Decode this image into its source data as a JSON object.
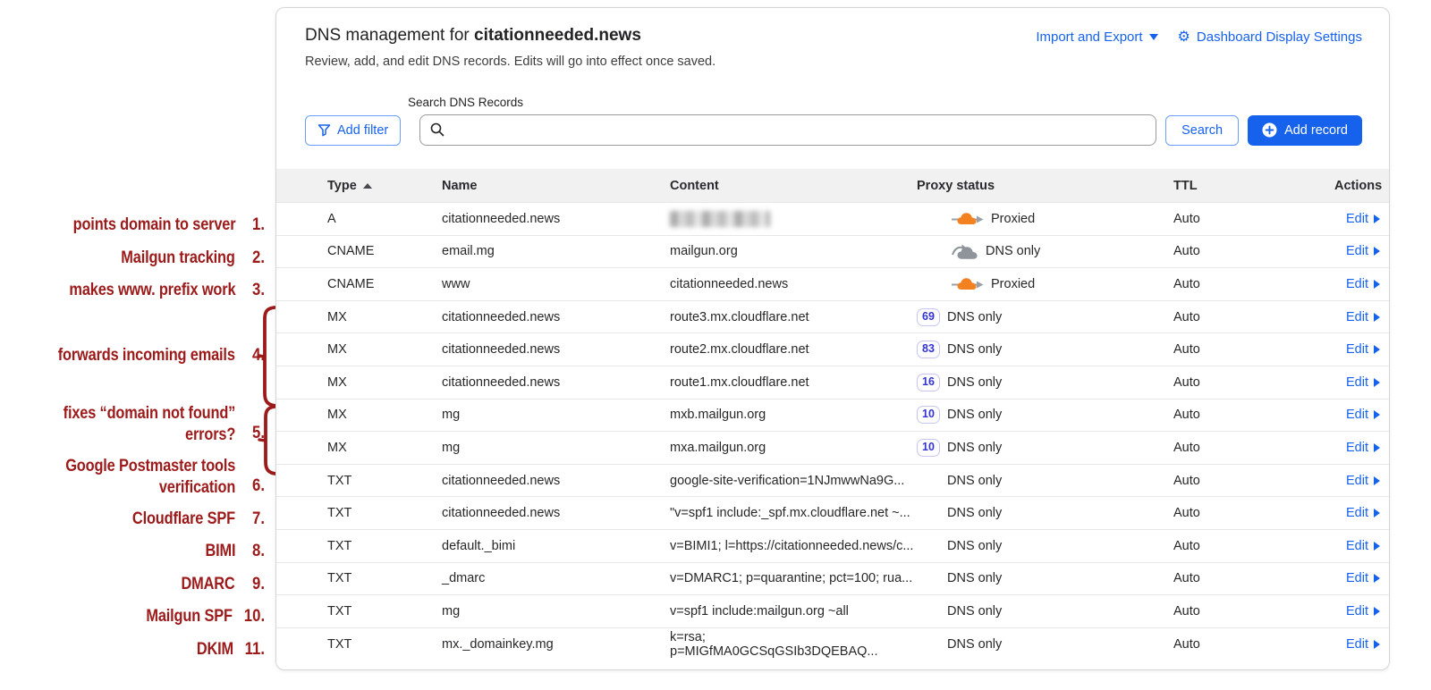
{
  "header": {
    "title_prefix": "DNS management for ",
    "domain": "citationneeded.news",
    "subtitle": "Review, add, and edit DNS records. Edits will go into effect once saved.",
    "import_export_label": "Import and Export",
    "display_settings_label": "Dashboard Display Settings"
  },
  "toolbar": {
    "add_filter_label": "Add filter",
    "search_field_label": "Search DNS Records",
    "search_value": "",
    "search_button_label": "Search",
    "add_record_label": "Add record"
  },
  "table": {
    "columns": [
      "Type",
      "Name",
      "Content",
      "Proxy status",
      "TTL",
      "Actions"
    ],
    "edit_label": "Edit",
    "rows": [
      {
        "type": "A",
        "name": "citationneeded.news",
        "content": "",
        "redacted": true,
        "proxy": {
          "variant": "proxied",
          "label": "Proxied"
        },
        "ttl": "Auto"
      },
      {
        "type": "CNAME",
        "name": "email.mg",
        "content": "mailgun.org",
        "proxy": {
          "variant": "dns-cloud",
          "label": "DNS only"
        },
        "ttl": "Auto"
      },
      {
        "type": "CNAME",
        "name": "www",
        "content": "citationneeded.news",
        "proxy": {
          "variant": "proxied",
          "label": "Proxied"
        },
        "ttl": "Auto"
      },
      {
        "type": "MX",
        "name": "citationneeded.news",
        "content": "route3.mx.cloudflare.net",
        "proxy": {
          "variant": "priority",
          "priority": "69",
          "label": "DNS only"
        },
        "ttl": "Auto"
      },
      {
        "type": "MX",
        "name": "citationneeded.news",
        "content": "route2.mx.cloudflare.net",
        "proxy": {
          "variant": "priority",
          "priority": "83",
          "label": "DNS only"
        },
        "ttl": "Auto"
      },
      {
        "type": "MX",
        "name": "citationneeded.news",
        "content": "route1.mx.cloudflare.net",
        "proxy": {
          "variant": "priority",
          "priority": "16",
          "label": "DNS only"
        },
        "ttl": "Auto"
      },
      {
        "type": "MX",
        "name": "mg",
        "content": "mxb.mailgun.org",
        "proxy": {
          "variant": "priority",
          "priority": "10",
          "label": "DNS only"
        },
        "ttl": "Auto"
      },
      {
        "type": "MX",
        "name": "mg",
        "content": "mxa.mailgun.org",
        "proxy": {
          "variant": "priority",
          "priority": "10",
          "label": "DNS only"
        },
        "ttl": "Auto"
      },
      {
        "type": "TXT",
        "name": "citationneeded.news",
        "content": "google-site-verification=1NJmwwNa9G...",
        "proxy": {
          "variant": "plain",
          "label": "DNS only"
        },
        "ttl": "Auto"
      },
      {
        "type": "TXT",
        "name": "citationneeded.news",
        "content": "\"v=spf1 include:_spf.mx.cloudflare.net ~...",
        "proxy": {
          "variant": "plain",
          "label": "DNS only"
        },
        "ttl": "Auto"
      },
      {
        "type": "TXT",
        "name": "default._bimi",
        "content": "v=BIMI1; l=https://citationneeded.news/c...",
        "proxy": {
          "variant": "plain",
          "label": "DNS only"
        },
        "ttl": "Auto"
      },
      {
        "type": "TXT",
        "name": "_dmarc",
        "content": "v=DMARC1; p=quarantine; pct=100; rua...",
        "proxy": {
          "variant": "plain",
          "label": "DNS only"
        },
        "ttl": "Auto"
      },
      {
        "type": "TXT",
        "name": "mg",
        "content": "v=spf1 include:mailgun.org ~all",
        "proxy": {
          "variant": "plain",
          "label": "DNS only"
        },
        "ttl": "Auto"
      },
      {
        "type": "TXT",
        "name": "mx._domainkey.mg",
        "content": "k=rsa; p=MIGfMA0GCSqGSIb3DQEBAQ...",
        "proxy": {
          "variant": "plain",
          "label": "DNS only"
        },
        "ttl": "Auto"
      }
    ]
  },
  "annotations": {
    "items": [
      {
        "lines": [
          "points domain to server"
        ],
        "num": "1."
      },
      {
        "lines": [
          "Mailgun tracking"
        ],
        "num": "2."
      },
      {
        "lines": [
          "makes www. prefix work"
        ],
        "num": "3."
      },
      {
        "lines": [
          "forwards incoming emails"
        ],
        "num": "4."
      },
      {
        "lines": [
          "fixes “domain not found”",
          "errors?"
        ],
        "num": "5."
      },
      {
        "lines": [
          "Google Postmaster tools",
          "verification"
        ],
        "num": "6."
      },
      {
        "lines": [
          "Cloudflare SPF"
        ],
        "num": "7."
      },
      {
        "lines": [
          "BIMI"
        ],
        "num": "8."
      },
      {
        "lines": [
          "DMARC"
        ],
        "num": "9."
      },
      {
        "lines": [
          "Mailgun SPF"
        ],
        "num": "10."
      },
      {
        "lines": [
          "DKIM"
        ],
        "num": "11."
      }
    ]
  },
  "colors": {
    "accent_blue": "#1662ec",
    "proxied_orange": "#f48120",
    "dns_only_gray": "#8e9499",
    "annotation_red": "#9c1a1a",
    "priority_badge": "#3434cf"
  }
}
